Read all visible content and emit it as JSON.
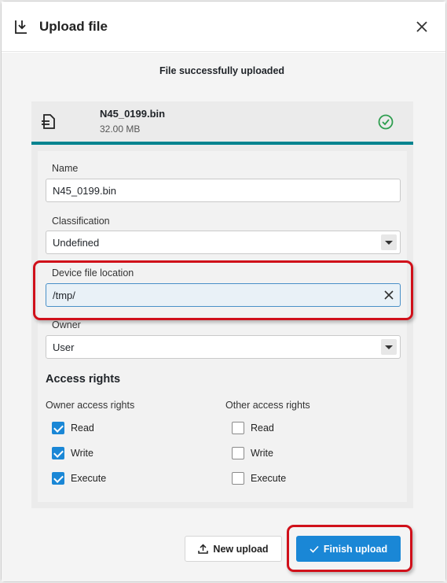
{
  "dialog": {
    "title": "Upload file",
    "title_icon": "download-icon",
    "close_icon": "close-icon"
  },
  "status_message": "File successfully uploaded",
  "file": {
    "name": "N45_0199.bin",
    "size": "32.00 MB",
    "icon": "file-icon",
    "status_icon": "check-circle-icon",
    "upload_progress": 1.0
  },
  "form": {
    "name": {
      "label": "Name",
      "value": "N45_0199.bin"
    },
    "classification": {
      "label": "Classification",
      "value": "Undefined"
    },
    "device_file_location": {
      "label": "Device file location",
      "value": "/tmp/"
    },
    "owner": {
      "label": "Owner",
      "value": "User"
    }
  },
  "access_rights": {
    "title": "Access rights",
    "owner": {
      "title": "Owner access rights",
      "items": [
        {
          "label": "Read",
          "checked": true
        },
        {
          "label": "Write",
          "checked": true
        },
        {
          "label": "Execute",
          "checked": true
        }
      ]
    },
    "other": {
      "title": "Other access rights",
      "items": [
        {
          "label": "Read",
          "checked": false
        },
        {
          "label": "Write",
          "checked": false
        },
        {
          "label": "Execute",
          "checked": false
        }
      ]
    }
  },
  "buttons": {
    "new_upload": "New upload",
    "finish_upload": "Finish upload"
  },
  "colors": {
    "accent": "#1a87d6",
    "progress": "#00838f",
    "success": "#2e9e4f",
    "highlight": "#d0101a"
  }
}
